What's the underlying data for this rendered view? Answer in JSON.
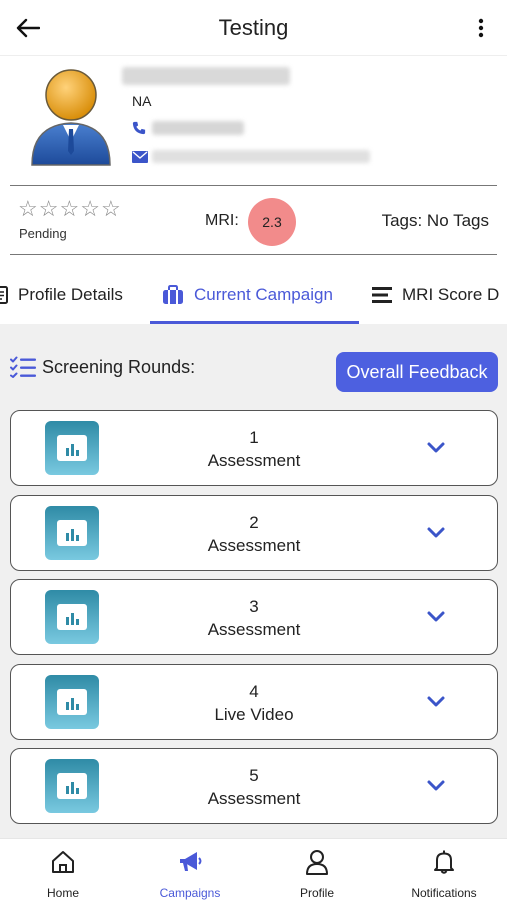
{
  "header": {
    "title": "Testing"
  },
  "profile": {
    "status_text": "NA"
  },
  "stats": {
    "rating": 0,
    "rating_max": 5,
    "rating_status": "Pending",
    "mri_label": "MRI:",
    "mri_score": "2.3",
    "tags_text": "Tags: No Tags"
  },
  "tabs": [
    {
      "label": "Profile Details"
    },
    {
      "label": "Current Campaign"
    },
    {
      "label": "MRI Score D"
    }
  ],
  "screening": {
    "title": "Screening Rounds:",
    "feedback_button": "Overall Feedback",
    "rounds": [
      {
        "number": "1",
        "name": "Assessment"
      },
      {
        "number": "2",
        "name": "Assessment"
      },
      {
        "number": "3",
        "name": "Assessment"
      },
      {
        "number": "4",
        "name": "Live Video"
      },
      {
        "number": "5",
        "name": "Assessment"
      }
    ]
  },
  "bottom_nav": [
    {
      "label": "Home",
      "icon": "home-icon"
    },
    {
      "label": "Campaigns",
      "icon": "megaphone-icon"
    },
    {
      "label": "Profile",
      "icon": "person-icon"
    },
    {
      "label": "Notifications",
      "icon": "bell-icon"
    }
  ],
  "colors": {
    "accent": "#4a59d8",
    "button": "#4d60e0",
    "mri_badge": "#f28b8b",
    "content_bg": "#f0f0f0"
  }
}
